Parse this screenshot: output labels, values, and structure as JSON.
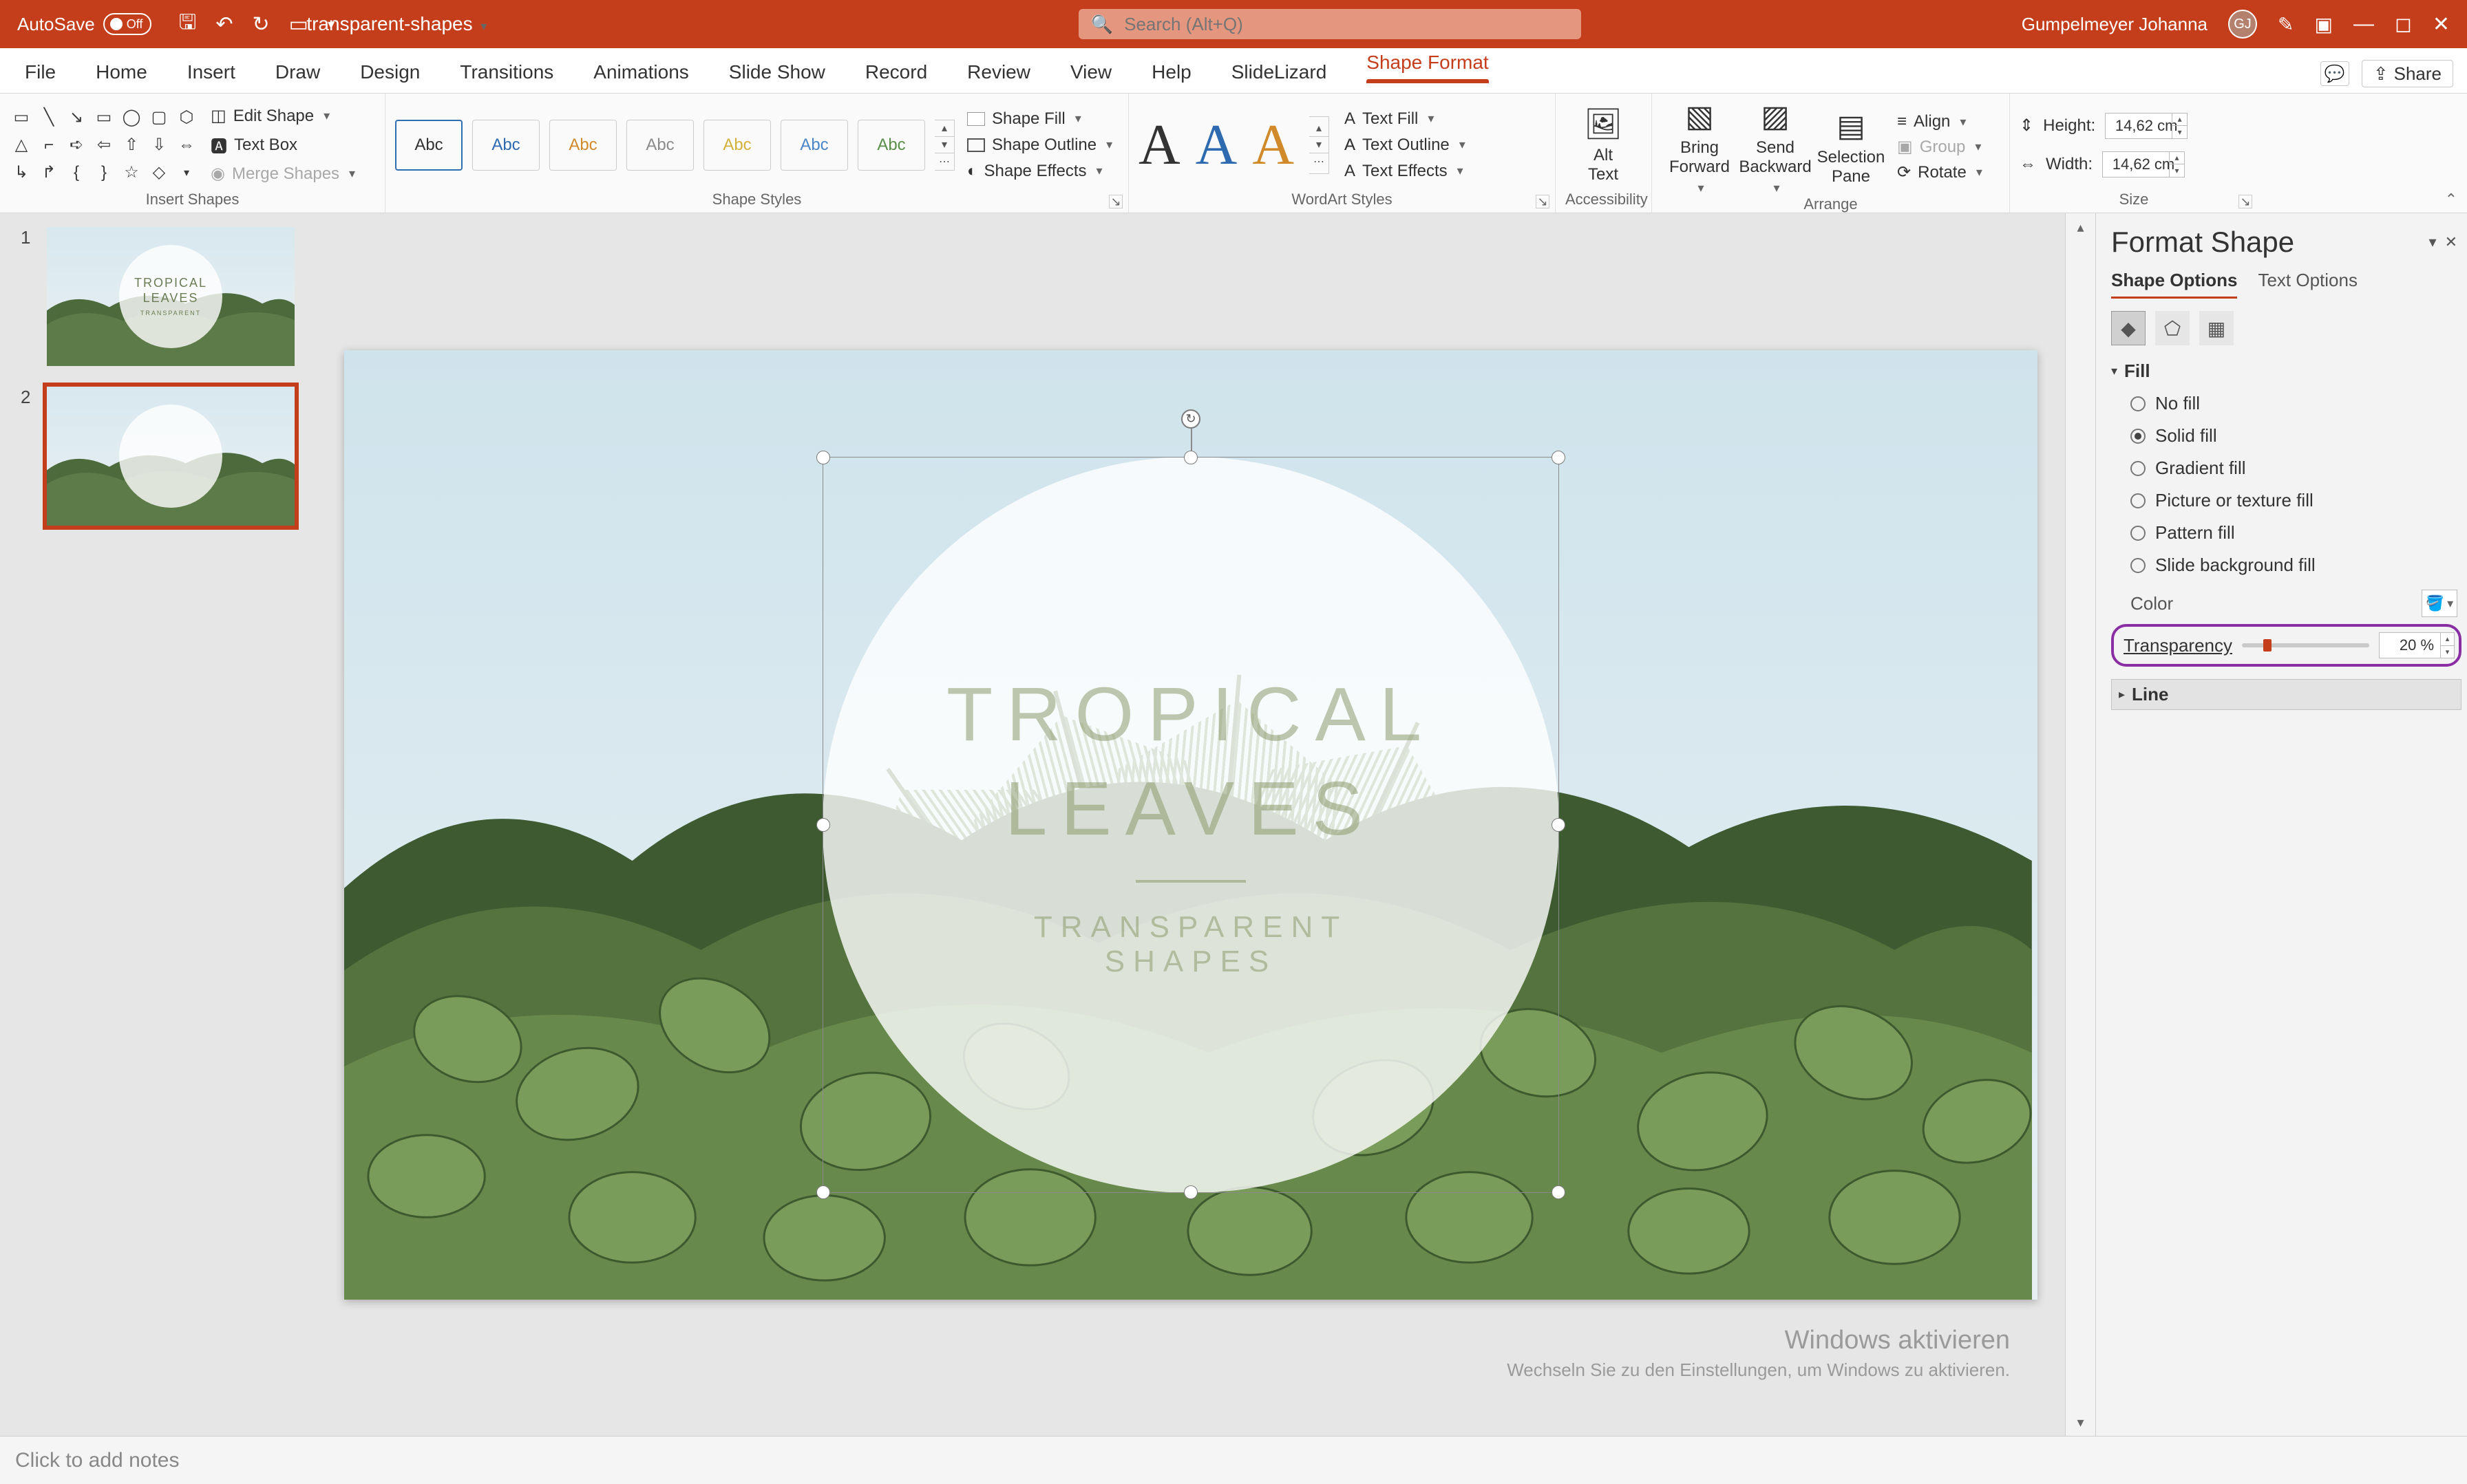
{
  "titlebar": {
    "autosave_label": "AutoSave",
    "autosave_state": "Off",
    "doc_name": "transparent-shapes",
    "search_placeholder": "Search (Alt+Q)",
    "user_name": "Gumpelmeyer Johanna",
    "user_initials": "GJ"
  },
  "tabs": {
    "file": "File",
    "home": "Home",
    "insert": "Insert",
    "draw": "Draw",
    "design": "Design",
    "transitions": "Transitions",
    "animations": "Animations",
    "slideshow": "Slide Show",
    "record": "Record",
    "review": "Review",
    "view": "View",
    "help": "Help",
    "slidelizard": "SlideLizard",
    "shapeformat": "Shape Format",
    "share": "Share"
  },
  "ribbon": {
    "insert_shapes": {
      "label": "Insert Shapes",
      "edit_shape": "Edit Shape",
      "text_box": "Text Box",
      "merge_shapes": "Merge Shapes"
    },
    "shape_styles": {
      "label": "Shape Styles",
      "swatch_text": "Abc",
      "shape_fill": "Shape Fill",
      "shape_outline": "Shape Outline",
      "shape_effects": "Shape Effects"
    },
    "wordart_styles": {
      "label": "WordArt Styles",
      "glyph": "A",
      "text_fill": "Text Fill",
      "text_outline": "Text Outline",
      "text_effects": "Text Effects"
    },
    "accessibility": {
      "label": "Accessibility",
      "alt_text": "Alt\nText"
    },
    "arrange": {
      "label": "Arrange",
      "bring_forward": "Bring\nForward",
      "send_backward": "Send\nBackward",
      "selection_pane": "Selection\nPane",
      "align": "Align",
      "group": "Group",
      "rotate": "Rotate"
    },
    "size": {
      "label": "Size",
      "height_label": "Height:",
      "height_value": "14,62 cm",
      "width_label": "Width:",
      "width_value": "14,62 cm"
    }
  },
  "slide_nav": {
    "n1": "1",
    "n2": "2"
  },
  "slide_content": {
    "line1": "TROPICAL",
    "line2": "LEAVES",
    "line3": "TRANSPARENT",
    "line4": "SHAPES"
  },
  "panel": {
    "title": "Format Shape",
    "tab_shape": "Shape Options",
    "tab_text": "Text Options",
    "section_fill": "Fill",
    "section_line": "Line",
    "fill_options": {
      "no_fill": "No fill",
      "solid_fill": "Solid fill",
      "gradient_fill": "Gradient fill",
      "picture_fill": "Picture or texture fill",
      "pattern_fill": "Pattern fill",
      "slide_bg_fill": "Slide background fill"
    },
    "color_label": "Color",
    "transparency_label": "Transparency",
    "transparency_value": "20 %",
    "transparency_percent": 20
  },
  "notes_placeholder": "Click to add notes",
  "watermark": {
    "line1": "Windows aktivieren",
    "line2": "Wechseln Sie zu den Einstellungen, um Windows zu aktivieren."
  }
}
